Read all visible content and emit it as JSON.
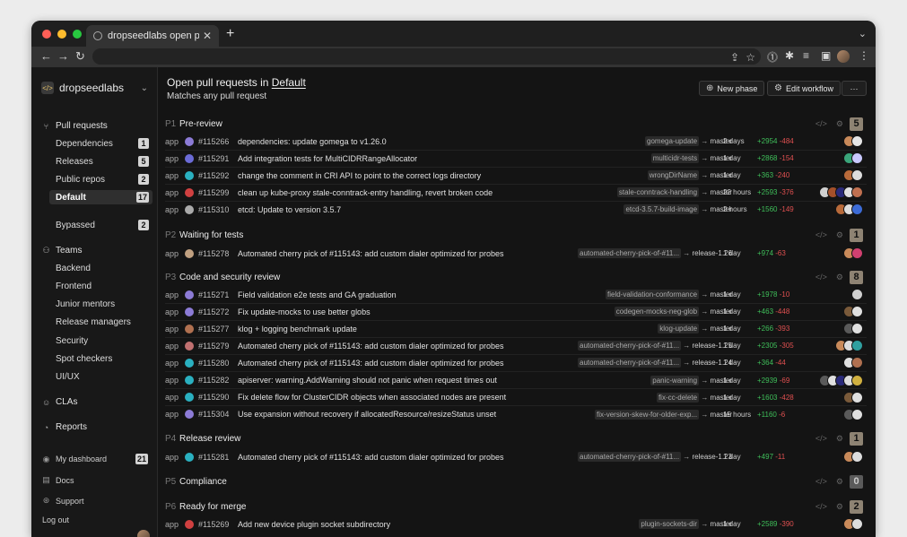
{
  "browser": {
    "tab_title": "dropseedlabs open pull requests",
    "new_tab": "+",
    "tab_menu": "⌄",
    "url": "",
    "extensions": [
      "share-icon",
      "star-icon",
      "extension-1password",
      "puzzle-icon",
      "media-icon",
      "sidebar-icon",
      "profile-avatar",
      "more-icon"
    ]
  },
  "sidebar": {
    "org_name": "dropseedlabs",
    "sections": {
      "pull_requests": "Pull requests",
      "teams": "Teams",
      "clas": "CLAs",
      "reports": "Reports"
    },
    "pr_items": [
      {
        "label": "Dependencies",
        "count": "1"
      },
      {
        "label": "Releases",
        "count": "5"
      },
      {
        "label": "Public repos",
        "count": "2"
      },
      {
        "label": "Default",
        "count": "17"
      },
      {
        "label": "Bypassed",
        "count": "2"
      }
    ],
    "teams": [
      "Backend",
      "Frontend",
      "Junior mentors",
      "Release managers",
      "Security",
      "Spot checkers",
      "UI/UX"
    ],
    "footer": {
      "dashboard": "My dashboard",
      "dashboard_count": "21",
      "docs": "Docs",
      "support": "Support",
      "logout": "Log out"
    }
  },
  "header": {
    "title_prefix": "Open pull requests in",
    "title_link": "Default",
    "subtitle": "Matches any pull request",
    "new_phase": "New phase",
    "edit_workflow": "Edit workflow",
    "more": "···"
  },
  "phases": [
    {
      "num": "P1",
      "name": "Pre-review",
      "count": "5",
      "rows": [
        {
          "repo": "app",
          "num": "#115266",
          "title": "dependencies: update gomega to v1.26.0",
          "head": "gomega-update",
          "base": "master",
          "age": "2 days",
          "add": "+2954",
          "del": "-484",
          "avatars": [
            "#c98a5a",
            "#e6e6e6"
          ],
          "icon": "#8c7bd6"
        },
        {
          "repo": "app",
          "num": "#115291",
          "title": "Add integration tests for MultiCIDRRangeAllocator",
          "head": "multicidr-tests",
          "base": "master",
          "age": "1 day",
          "add": "+2868",
          "del": "-154",
          "avatars": [
            "#3aa57a",
            "#c9c9ff"
          ],
          "icon": "#6b6bd6"
        },
        {
          "repo": "app",
          "num": "#115292",
          "title": "change the comment in CRI API to point to the correct logs directory",
          "head": "wrongDirName",
          "base": "master",
          "age": "1 day",
          "add": "+363",
          "del": "-240",
          "avatars": [
            "#b86a3a",
            "#dddddd"
          ],
          "icon": "#2ab0c0"
        },
        {
          "repo": "app",
          "num": "#115299",
          "title": "clean up kube-proxy stale-conntrack-entry handling, revert broken code",
          "head": "stale-conntrack-handling",
          "base": "master",
          "age": "22 hours",
          "add": "+2593",
          "del": "-376",
          "avatars": [
            "#d0d0d0",
            "#a4502a",
            "#2a2a7a",
            "#e0e0e0",
            "#c07050"
          ],
          "icon": "#d04040"
        },
        {
          "repo": "app",
          "num": "#115310",
          "title": "etcd: Update to version 3.5.7",
          "head": "etcd-3.5.7-build-image",
          "base": "master",
          "age": "2 hours",
          "add": "+1560",
          "del": "-149",
          "avatars": [
            "#b86a3a",
            "#dddddd",
            "#3c6bd6"
          ],
          "icon": "#aaaaaa"
        }
      ]
    },
    {
      "num": "P2",
      "name": "Waiting for tests",
      "count": "1",
      "rows": [
        {
          "repo": "app",
          "num": "#115278",
          "title": "Automated cherry pick of #115143: add custom dialer optimized for probes",
          "head": "automated-cherry-pick-of-#11...",
          "base": "release-1.26",
          "age": "1 day",
          "add": "+974",
          "del": "-63",
          "avatars": [
            "#c98a5a",
            "#d04070"
          ],
          "icon": "#c0a080"
        }
      ]
    },
    {
      "num": "P3",
      "name": "Code and security review",
      "count": "8",
      "rows": [
        {
          "repo": "app",
          "num": "#115271",
          "title": "Field validation e2e tests and GA graduation",
          "head": "field-validation-conformance",
          "base": "master",
          "age": "1 day",
          "add": "+1978",
          "del": "-10",
          "avatars": [
            "#d0d0d0"
          ],
          "icon": "#8c7bd6"
        },
        {
          "repo": "app",
          "num": "#115272",
          "title": "Fix update-mocks to use better globs",
          "head": "codegen-mocks-neg-glob",
          "base": "master",
          "age": "1 day",
          "add": "+463",
          "del": "-448",
          "avatars": [
            "#7a5a3a",
            "#e0e0e0"
          ],
          "icon": "#8c7bd6"
        },
        {
          "repo": "app",
          "num": "#115277",
          "title": "klog + logging benchmark update",
          "head": "klog-update",
          "base": "master",
          "age": "1 day",
          "add": "+266",
          "del": "-393",
          "avatars": [
            "#5a5a5a",
            "#e0e0e0"
          ],
          "icon": "#b07050"
        },
        {
          "repo": "app",
          "num": "#115279",
          "title": "Automated cherry pick of #115143: add custom dialer optimized for probes",
          "head": "automated-cherry-pick-of-#11...",
          "base": "release-1.25",
          "age": "1 day",
          "add": "+2305",
          "del": "-305",
          "avatars": [
            "#c98a5a",
            "#dddddd",
            "#30a0a0"
          ],
          "icon": "#c07070"
        },
        {
          "repo": "app",
          "num": "#115280",
          "title": "Automated cherry pick of #115143: add custom dialer optimized for probes",
          "head": "automated-cherry-pick-of-#11...",
          "base": "release-1.24",
          "age": "1 day",
          "add": "+364",
          "del": "-44",
          "avatars": [
            "#e0e0e0",
            "#b07050"
          ],
          "icon": "#2ab0c0"
        },
        {
          "repo": "app",
          "num": "#115282",
          "title": "apiserver: warning.AddWarning should not panic when request times out",
          "head": "panic-warning",
          "base": "master",
          "age": "1 day",
          "add": "+2939",
          "del": "-69",
          "avatars": [
            "#5a5a5a",
            "#e0e0e0",
            "#2a2a7a",
            "#dddddd",
            "#d0b040"
          ],
          "icon": "#2ab0c0"
        },
        {
          "repo": "app",
          "num": "#115290",
          "title": "Fix delete flow for ClusterCIDR objects when associated nodes are present",
          "head": "fix-cc-delete",
          "base": "master",
          "age": "1 day",
          "add": "+1603",
          "del": "-428",
          "avatars": [
            "#7a5a3a",
            "#e0e0e0"
          ],
          "icon": "#2ab0c0"
        },
        {
          "repo": "app",
          "num": "#115304",
          "title": "Use expansion without recovery if allocatedResource/resizeStatus unset",
          "head": "fix-version-skew-for-older-exp...",
          "base": "master",
          "age": "15 hours",
          "add": "+1160",
          "del": "-6",
          "avatars": [
            "#5a5a5a",
            "#e0e0e0"
          ],
          "icon": "#8c7bd6"
        }
      ]
    },
    {
      "num": "P4",
      "name": "Release review",
      "count": "1",
      "rows": [
        {
          "repo": "app",
          "num": "#115281",
          "title": "Automated cherry pick of #115143: add custom dialer optimized for probes",
          "head": "automated-cherry-pick-of-#11...",
          "base": "release-1.23",
          "age": "1 day",
          "add": "+497",
          "del": "-11",
          "avatars": [
            "#c98a5a",
            "#dddddd"
          ],
          "icon": "#2ab0c0"
        }
      ]
    },
    {
      "num": "P5",
      "name": "Compliance",
      "count": "0",
      "rows": []
    },
    {
      "num": "P6",
      "name": "Ready for merge",
      "count": "2",
      "rows": [
        {
          "repo": "app",
          "num": "#115269",
          "title": "Add new device plugin socket subdirectory",
          "head": "plugin-sockets-dir",
          "base": "master",
          "age": "1 day",
          "add": "+2589",
          "del": "-390",
          "avatars": [
            "#c98a5a",
            "#dddddd"
          ],
          "icon": "#d04040"
        }
      ]
    }
  ],
  "colors": {
    "accent_add": "#3fbf5a",
    "accent_del": "#e05050",
    "count_badge": "#8e8373"
  }
}
